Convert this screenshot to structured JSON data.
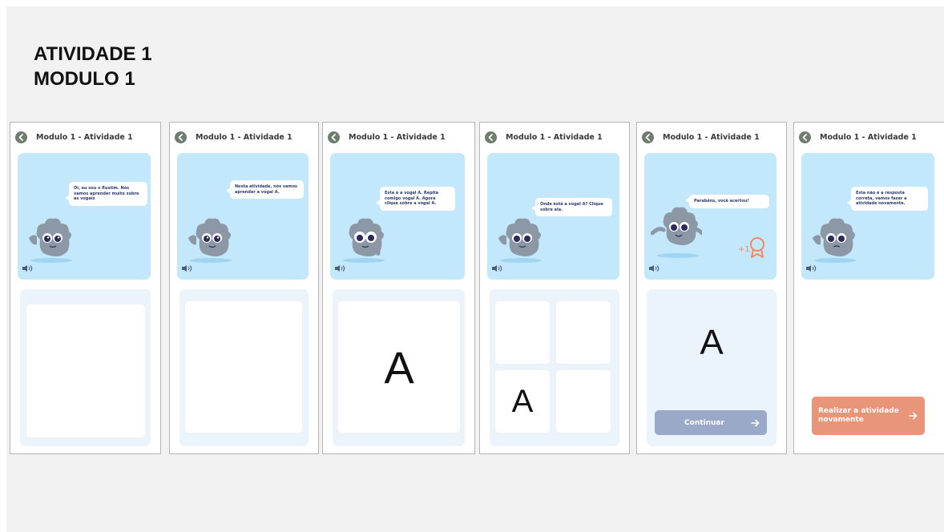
{
  "heading": {
    "line1": "ATIVIDADE 1",
    "line2": "MODULO 1"
  },
  "colors": {
    "story_bg": "#c4e8fb",
    "panel_bg": "#ebf4fb",
    "mascot": "#8d98a6",
    "continue_button": "#9aa9c7",
    "retry_button": "#e9957a",
    "award": "#f08a5d"
  },
  "screens": [
    {
      "title": "Modulo 1 - Atividade 1",
      "bubble": "Oi, eu sou o Rustim. Nós vamos aprender muito sobre as vogais",
      "sound_icon": "speaker-icon"
    },
    {
      "title": "Modulo 1 - Atividade 1",
      "bubble": "Nesta atividade, nós vamos aprender a vogal A.",
      "sound_icon": "speaker-icon"
    },
    {
      "title": "Modulo 1 - Atividade 1",
      "bubble": "Esta é a vogal A. Repita comigo vogal A. Agora clique sobre a vogal A.",
      "letter": "A",
      "sound_icon": "speaker-icon"
    },
    {
      "title": "Modulo 1 - Atividade 1",
      "bubble": "Onde está a vogal A? Clique sobre ela.",
      "letter": "A",
      "sound_icon": "speaker-icon"
    },
    {
      "title": "Modulo 1 - Atividade 1",
      "bubble": "Parabéns, você acertou!",
      "award_text": "+1",
      "award_icon": "ribbon-award-icon",
      "letter": "A",
      "button": "Continuar",
      "sound_icon": "speaker-icon"
    },
    {
      "title": "Modulo 1 - Atividade 1",
      "bubble": "Esta não é a resposta correta, vamos fazer a atividade novamente.",
      "button": "Realizar a atividade novamente",
      "sound_icon": "speaker-icon"
    }
  ]
}
